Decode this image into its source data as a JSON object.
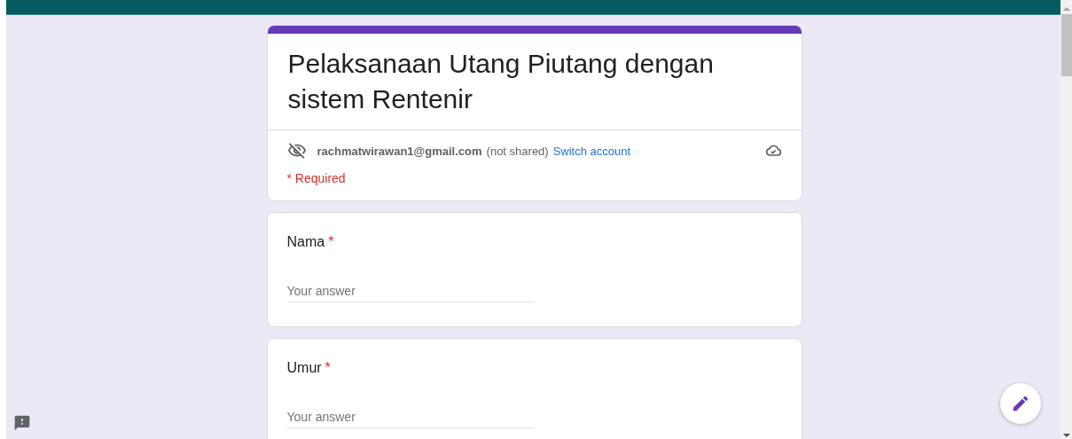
{
  "form": {
    "title": "Pelaksanaan Utang Piutang dengan sistem Rentenir",
    "account": {
      "email": "rachmatwirawan1@gmail.com",
      "note": "(not shared)",
      "switch_link": "Switch account"
    },
    "required_note": "* Required"
  },
  "questions": [
    {
      "label": "Nama",
      "required_mark": "*",
      "placeholder": "Your answer"
    },
    {
      "label": "Umur",
      "required_mark": "*",
      "placeholder": "Your answer"
    }
  ]
}
